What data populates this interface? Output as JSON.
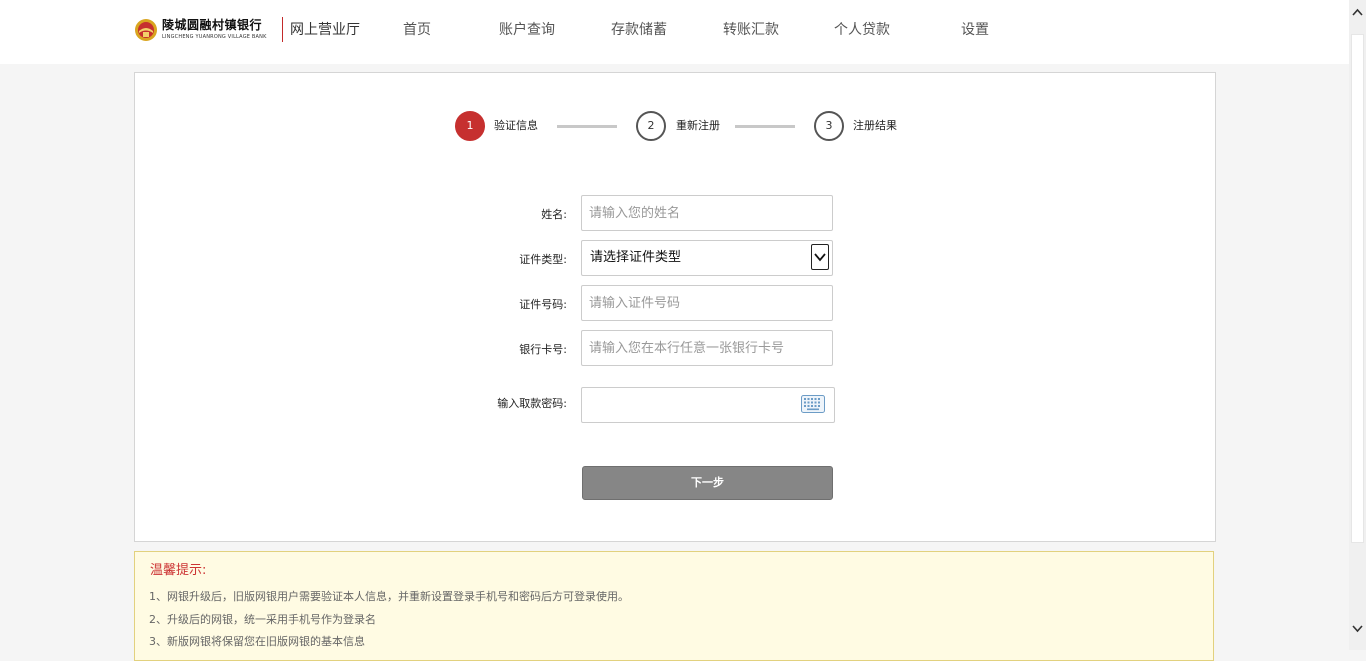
{
  "header": {
    "logo_cn": "陵城圆融村镇银行",
    "logo_en": "LINGCHENG YUANRONG VILLAGE BANK",
    "hall_label": "网上营业厅",
    "nav": [
      "首页",
      "账户查询",
      "存款储蓄",
      "转账汇款",
      "个人贷款",
      "设置"
    ]
  },
  "steps": [
    {
      "number": "1",
      "label": "验证信息",
      "active": true
    },
    {
      "number": "2",
      "label": "重新注册",
      "active": false
    },
    {
      "number": "3",
      "label": "注册结果",
      "active": false
    }
  ],
  "form": {
    "name": {
      "label": "姓名:",
      "placeholder": "请输入您的姓名",
      "value": ""
    },
    "id_type": {
      "label": "证件类型:",
      "selected": "请选择证件类型"
    },
    "id_number": {
      "label": "证件号码:",
      "placeholder": "请输入证件号码",
      "value": ""
    },
    "card_number": {
      "label": "银行卡号:",
      "placeholder": "请输入您在本行任意一张银行卡号",
      "value": ""
    },
    "password": {
      "label": "输入取款密码:",
      "value": ""
    },
    "next_button": "下一步"
  },
  "tips": {
    "title": "温馨提示:",
    "lines": [
      "1、网银升级后，旧版网银用户需要验证本人信息，并重新设置登录手机号和密码后方可登录使用。",
      "2、升级后的网银，统一采用手机号作为登录名",
      "3、新版网银将保留您在旧版网银的基本信息"
    ]
  },
  "colors": {
    "brand_red": "#c6302f",
    "button_gray": "#868686",
    "tips_background": "#fffbe3",
    "tips_title": "#cc3333"
  },
  "icons": {
    "logo": "bank-emblem-icon",
    "keyboard": "keyboard-icon",
    "select_arrow": "chevron-down-icon",
    "scroll_up": "chevron-up-icon",
    "scroll_down": "chevron-down-icon"
  }
}
